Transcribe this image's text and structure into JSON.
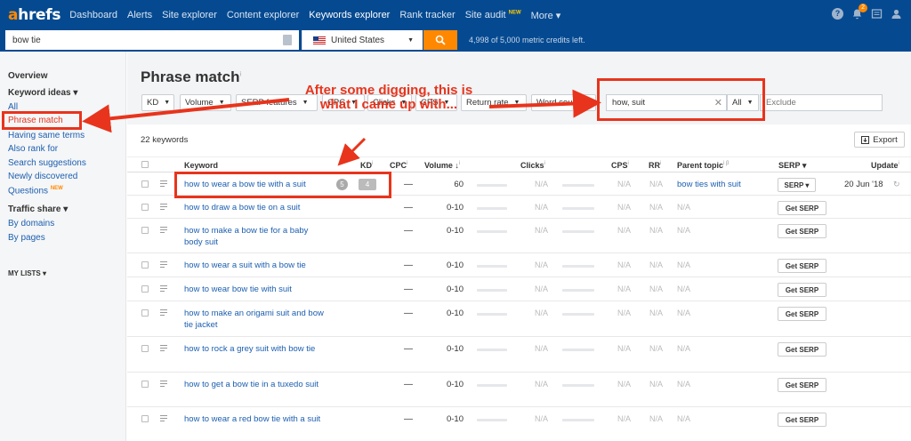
{
  "nav": {
    "logo_a": "a",
    "logo_rest": "hrefs",
    "items": [
      {
        "label": "Dashboard"
      },
      {
        "label": "Alerts"
      },
      {
        "label": "Site explorer"
      },
      {
        "label": "Content explorer"
      },
      {
        "label": "Keywords explorer",
        "active": true
      },
      {
        "label": "Rank tracker"
      },
      {
        "label": "Site audit",
        "badge": "NEW"
      },
      {
        "label": "More ▾"
      }
    ],
    "notifications_count": "2"
  },
  "search": {
    "query": "bow tie",
    "country": "United States",
    "credits": "4,998 of 5,000 metric credits left."
  },
  "sidebar": {
    "overview": "Overview",
    "keyword_ideas": "Keyword ideas ▾",
    "items": [
      {
        "label": "All"
      },
      {
        "label": "Phrase match",
        "active": true
      },
      {
        "label": "Having same terms"
      },
      {
        "label": "Also rank for"
      },
      {
        "label": "Search suggestions"
      },
      {
        "label": "Newly discovered"
      },
      {
        "label": "Questions",
        "badge": "NEW"
      }
    ],
    "traffic_share": "Traffic share ▾",
    "traffic_items": [
      {
        "label": "By domains"
      },
      {
        "label": "By pages"
      }
    ],
    "my_lists": "MY LISTS ▾"
  },
  "page": {
    "title": "Phrase match",
    "filters": [
      "KD",
      "Volume",
      "SERP features",
      "CPC",
      "Clicks",
      "CPS",
      "Return rate",
      "Word count"
    ],
    "phrase_value": "how, suit",
    "phrase_mode": "All",
    "exclude_placeholder": "Exclude",
    "count": "22 keywords",
    "export_label": "Export"
  },
  "table": {
    "headers": {
      "keyword": "Keyword",
      "kd": "KD",
      "cpc": "CPC",
      "volume": "Volume ↓",
      "clicks": "Clicks",
      "cps": "CPS",
      "rr": "RR",
      "parent": "Parent topic",
      "serp": "SERP",
      "update": "Update"
    },
    "rows": [
      {
        "keyword": "how to wear a bow tie with a suit",
        "kd_pill": "5",
        "kd": "4",
        "cpc": "—",
        "volume": "60",
        "clicks": "N/A",
        "cps": "N/A",
        "rr": "N/A",
        "parent": "bow ties with suit",
        "serp": "SERP ▾",
        "update": "20 Jun '18"
      },
      {
        "keyword": "how to draw a bow tie on a suit",
        "cpc": "—",
        "volume": "0-10",
        "clicks": "N/A",
        "cps": "N/A",
        "rr": "N/A",
        "parent": "N/A",
        "serp": "Get SERP"
      },
      {
        "keyword": "how to make a bow tie for a baby body suit",
        "cpc": "—",
        "volume": "0-10",
        "clicks": "N/A",
        "cps": "N/A",
        "rr": "N/A",
        "parent": "N/A",
        "serp": "Get SERP"
      },
      {
        "keyword": "how to wear a suit with a bow tie",
        "cpc": "—",
        "volume": "0-10",
        "clicks": "N/A",
        "cps": "N/A",
        "rr": "N/A",
        "parent": "N/A",
        "serp": "Get SERP"
      },
      {
        "keyword": "how to wear bow tie with suit",
        "cpc": "—",
        "volume": "0-10",
        "clicks": "N/A",
        "cps": "N/A",
        "rr": "N/A",
        "parent": "N/A",
        "serp": "Get SERP"
      },
      {
        "keyword": "how to make an origami suit and bow tie jacket",
        "cpc": "—",
        "volume": "0-10",
        "clicks": "N/A",
        "cps": "N/A",
        "rr": "N/A",
        "parent": "N/A",
        "serp": "Get SERP"
      },
      {
        "keyword": "how to rock a grey suit with bow tie",
        "cpc": "—",
        "volume": "0-10",
        "clicks": "N/A",
        "cps": "N/A",
        "rr": "N/A",
        "parent": "N/A",
        "serp": "Get SERP"
      },
      {
        "keyword": "how to get a bow tie in a tuxedo suit",
        "cpc": "—",
        "volume": "0-10",
        "clicks": "N/A",
        "cps": "N/A",
        "rr": "N/A",
        "parent": "N/A",
        "serp": "Get SERP"
      },
      {
        "keyword": "how to wear a red bow tie with a suit",
        "cpc": "—",
        "volume": "0-10",
        "clicks": "N/A",
        "cps": "N/A",
        "rr": "N/A",
        "parent": "N/A",
        "serp": "Get SERP"
      }
    ]
  },
  "annotation": {
    "line1": "After some digging, this is",
    "line2": "what I came up with...",
    "color": "#e8341c"
  },
  "colors": {
    "nav": "#054a91",
    "accent": "#ff8800",
    "link": "#1c5fb0"
  }
}
